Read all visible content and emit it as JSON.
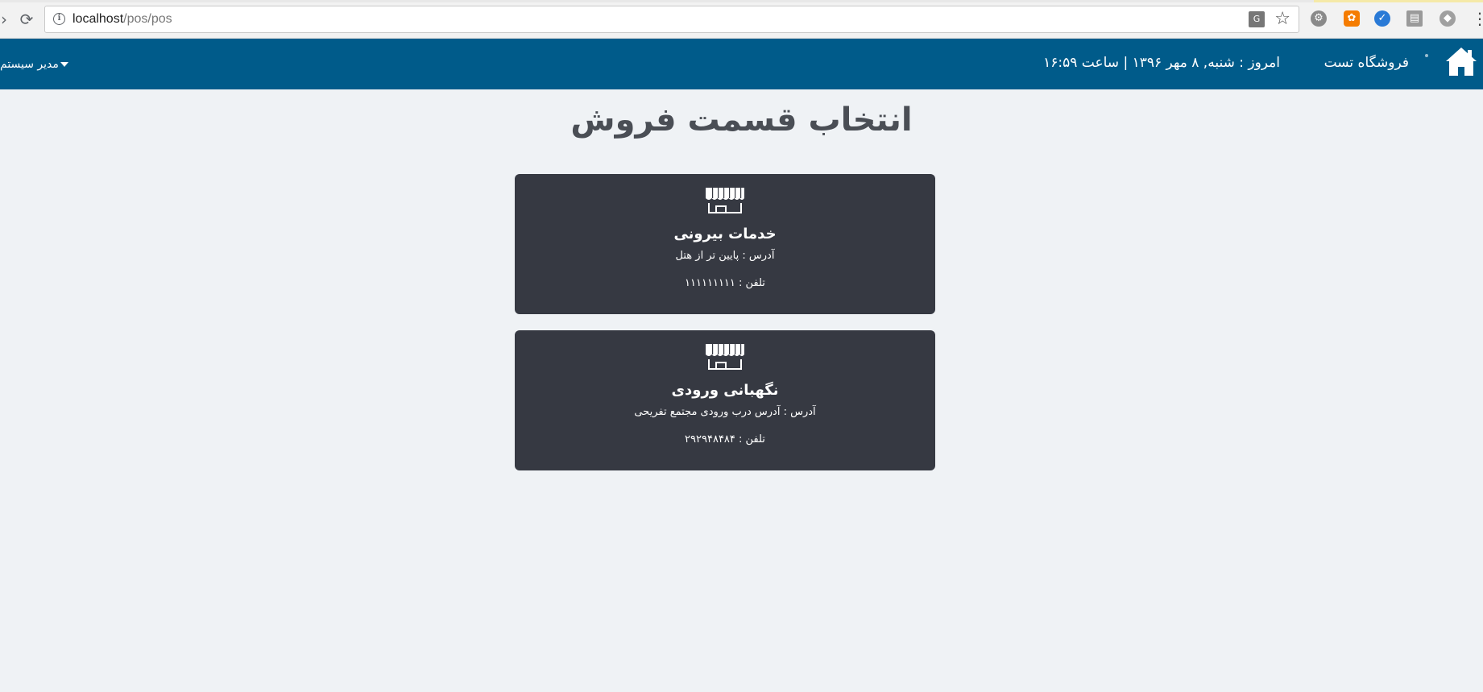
{
  "browser": {
    "url_host": "localhost",
    "url_path": "/pos/pos",
    "translate_label": "G"
  },
  "header": {
    "store_name": "فروشگاه تست",
    "date_text": "امروز : شنبه, ۸ مهر ۱۳۹۶ | ساعت ۱۶:۵۹",
    "user_menu": "مدیر سیستم"
  },
  "main": {
    "title": "انتخاب قسمت فروش",
    "sections": [
      {
        "name": "خدمات بیرونی",
        "address": "آدرس : پایین تر از هتل",
        "phone": "تلفن : ۱۱۱۱۱۱۱۱۱"
      },
      {
        "name": "نگهبانی ورودی",
        "address": "آدرس : آدرس درب ورودی مجتمع تفریحی",
        "phone": "تلفن : ۲۹۲۹۴۸۴۸۴"
      }
    ]
  },
  "colors": {
    "header_bg": "#005b8a",
    "card_bg": "#363942",
    "page_bg": "#eff2f5"
  }
}
